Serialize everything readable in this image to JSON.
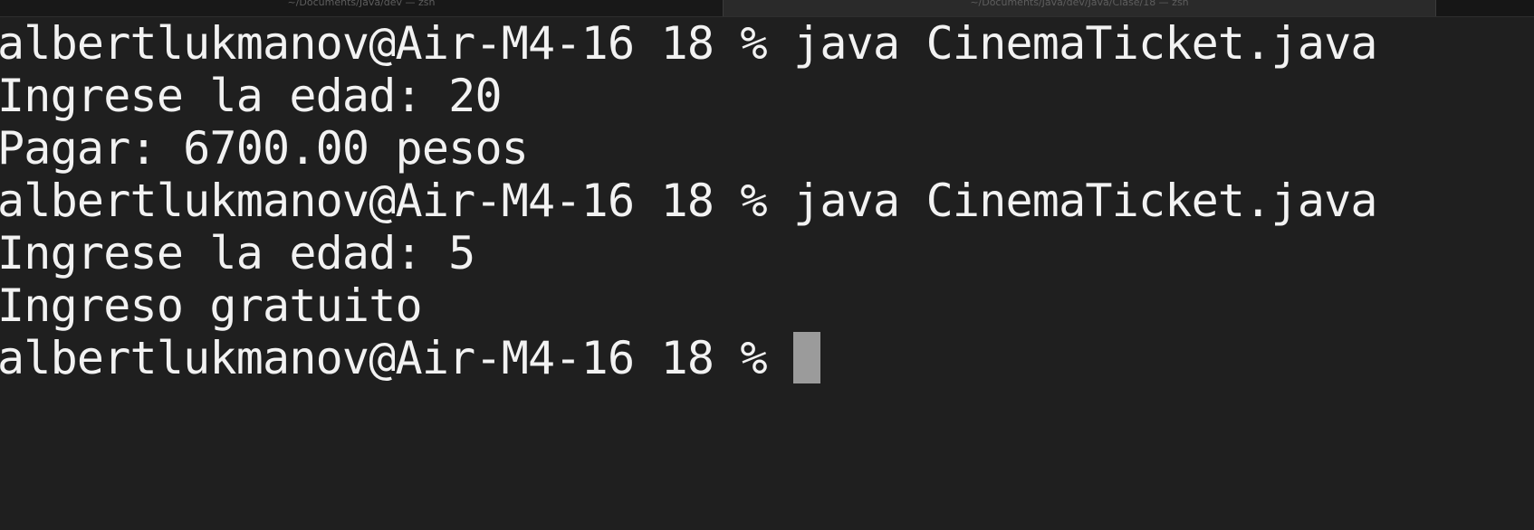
{
  "tabs": [
    {
      "label": "~/Documents/Java/dev — zsh"
    },
    {
      "label": "~/Documents/Java/dev/Java/Clase/18 — zsh"
    }
  ],
  "terminal": {
    "lines": [
      "albertlukmanov@Air-M4-16 18 % java CinemaTicket.java",
      "Ingrese la edad: 20",
      "Pagar: 6700.00 pesos",
      "albertlukmanov@Air-M4-16 18 % java CinemaTicket.java",
      "Ingrese la edad: 5",
      "Ingreso gratuito"
    ],
    "prompt": "albertlukmanov@Air-M4-16 18 % "
  },
  "colors": {
    "background": "#1f1f1f",
    "text": "#f2f2f2",
    "cursor": "#9b9b9b"
  }
}
